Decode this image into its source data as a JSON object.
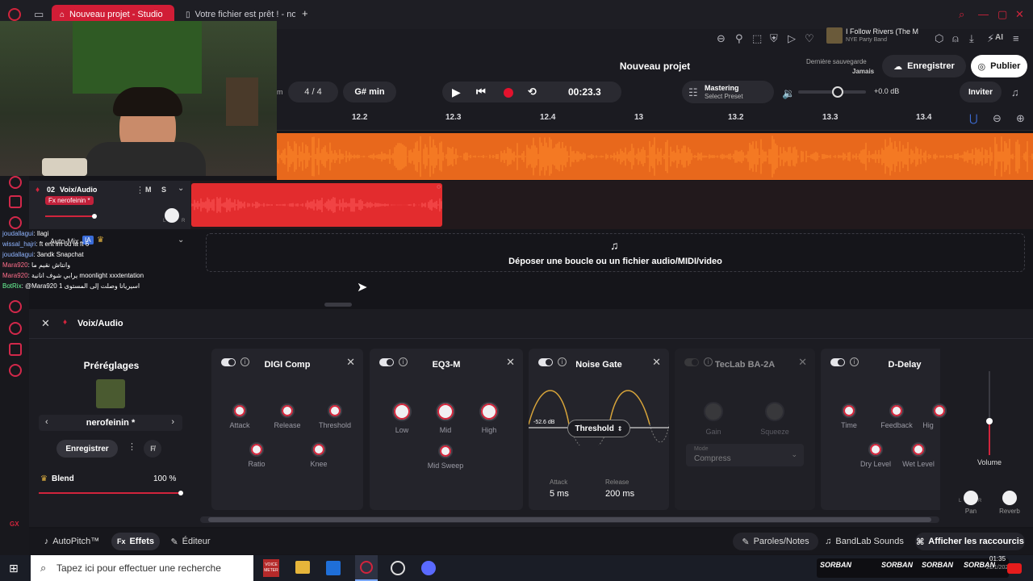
{
  "browser": {
    "tabs": [
      {
        "label": "Nouveau projet - Studio",
        "active": true
      },
      {
        "label": "Votre fichier est prêt ! - no"
      }
    ],
    "new_tab": "+"
  },
  "extensions": {
    "media_title": "I Follow Rivers (The Ma",
    "media_artist": "NYE Party Band",
    "ai_label": "AI"
  },
  "header": {
    "project_title": "Nouveau projet",
    "last_save_label": "Dernière sauvegarde",
    "last_save_value": "Jamais",
    "save_button": "Enregistrer",
    "publish_button": "Publier",
    "bpm_suffix": "m",
    "time_signature": "4 / 4",
    "key": "G# min",
    "time_display": "00:23.3",
    "mastering_label": "Mastering",
    "mastering_preset": "Select Preset",
    "volume_db": "+0.0 dB",
    "invite_button": "Inviter"
  },
  "ruler": {
    "ticks": [
      "12.2",
      "12.3",
      "12.4",
      "13",
      "13.2",
      "13.3",
      "13.4"
    ]
  },
  "track": {
    "number": "02",
    "name": "Voix/Audio",
    "mute": "M",
    "solo": "S",
    "fx_tag": "Fx nerofeinin *",
    "pan_l": "L",
    "pan_r": "R"
  },
  "automation": {
    "label": "Auto-Mix",
    "badge": "IA"
  },
  "drop_zone": {
    "text": "Déposer une boucle ou un fichier audio/MIDI/video"
  },
  "chat": [
    {
      "user": "joudallagui",
      "msg": ": Ilagi"
    },
    {
      "user": "wissal_hajri",
      "msg": ": ft ent lm ou ia ft 6"
    },
    {
      "user": "joudallagui",
      "msg": ": 3andk Snapchat"
    },
    {
      "user": "Mara920",
      "msg": ": وانتاش نقيم ما"
    },
    {
      "user": "Mara920",
      "msg": ": يرابي شوف انانية moonlight xxxtentation"
    },
    {
      "user": "BotRix",
      "msg": ": @Mara920 اسيريانا وصلت إلى المستوى 1"
    }
  ],
  "fx_panel": {
    "track_name": "Voix/Audio",
    "presets_title": "Préréglages",
    "preset_name": "nerofeinin *",
    "save_button": "Enregistrer",
    "blend_label": "Blend",
    "blend_value": "100 %",
    "blend_fraction": 1.0,
    "volume_label": "Volume",
    "volume_level": 0.4,
    "pan_label": "Pan",
    "reverb_label": "Reverb",
    "pan_l": "L",
    "pan_r": "R"
  },
  "effects": {
    "digi_comp": {
      "title": "DIGI Comp",
      "knobs": [
        "Attack",
        "Release",
        "Threshold",
        "Ratio",
        "Knee"
      ]
    },
    "eq3m": {
      "title": "EQ3-M",
      "knobs": [
        "Low",
        "Mid",
        "High",
        "Mid Sweep"
      ]
    },
    "noise_gate": {
      "title": "Noise Gate",
      "db_label": "-52.6 dB",
      "threshold_label": "Threshold",
      "attack_label": "Attack",
      "attack_value": "5 ms",
      "release_label": "Release",
      "release_value": "200 ms"
    },
    "teclab": {
      "title": "TecLab BA-2A",
      "knobs": [
        "Gain",
        "Squeeze"
      ],
      "mode_label": "Mode",
      "mode_value": "Compress"
    },
    "d_delay": {
      "title": "D-Delay",
      "knobs": [
        "Time",
        "Feedback",
        "Hig",
        "Dry Level",
        "Wet Level"
      ]
    }
  },
  "bottom_bar": {
    "autopitch": "AutoPitch™",
    "effects": "Effets",
    "editor": "Éditeur",
    "lyrics": "Paroles/Notes",
    "sounds": "BandLab Sounds",
    "shortcuts": "Afficher les raccourcis"
  },
  "left_rail": {
    "gx_label": "GX"
  },
  "taskbar": {
    "search_placeholder": "Tapez ici pour effectuer une recherche",
    "voice_app": "VOICE\nMETER",
    "clock": "01:35",
    "date": "21/1/2025",
    "overlay_tags": [
      "SORBAN",
      "SORBAN",
      "SORBAN",
      "SORBAN"
    ]
  }
}
